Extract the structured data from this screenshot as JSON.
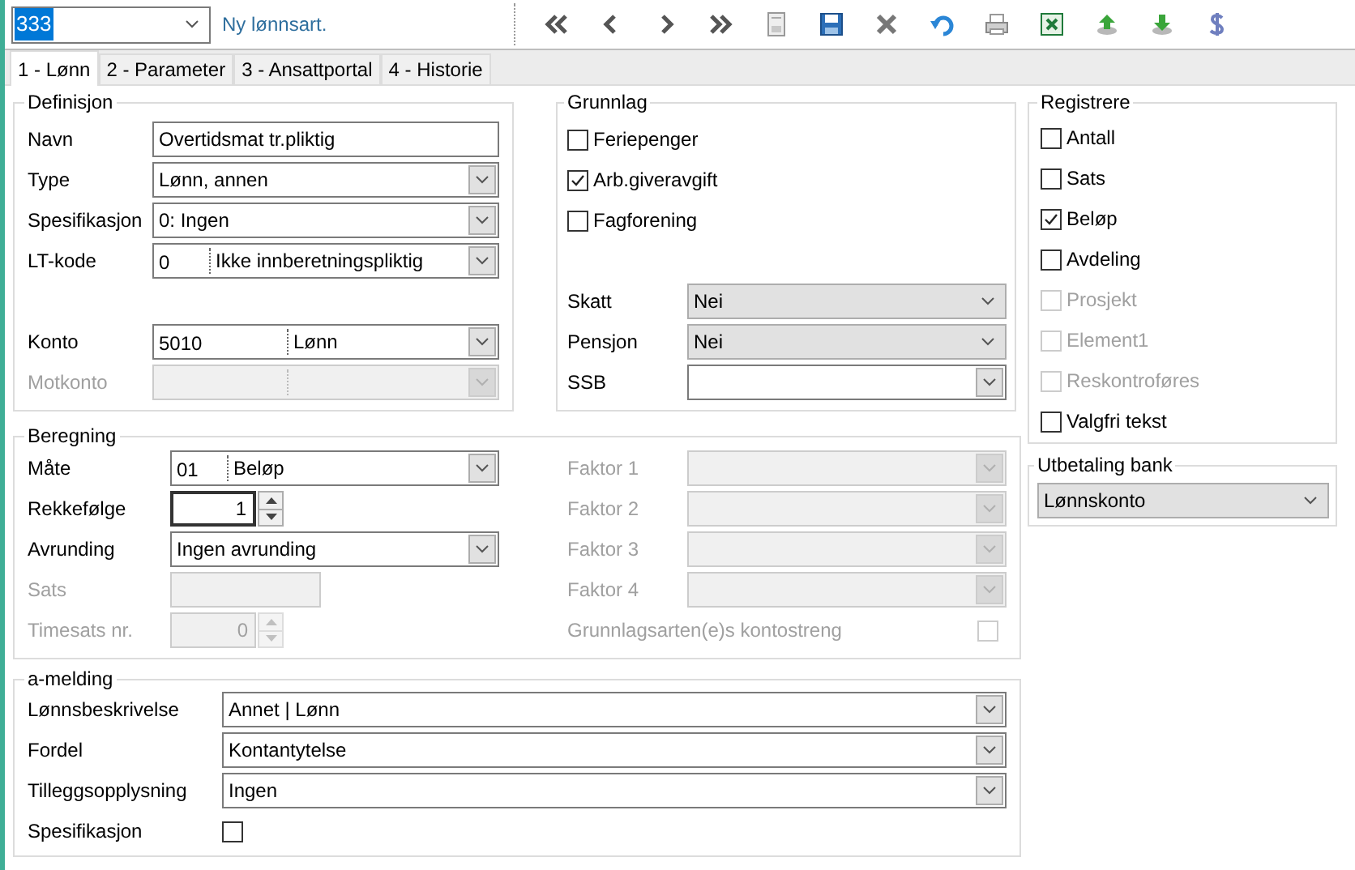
{
  "toolbar": {
    "record": {
      "value": "333",
      "highlighted": true
    },
    "status": "Ny lønnsart."
  },
  "tabs": [
    {
      "label": "1 - Lønn",
      "selected": true
    },
    {
      "label": "2 - Parameter",
      "selected": false
    },
    {
      "label": "3 - Ansattportal",
      "selected": false
    },
    {
      "label": "4 - Historie",
      "selected": false
    }
  ],
  "definisjon": {
    "title": "Definisjon",
    "rows": [
      {
        "label": "Navn",
        "kind": "text",
        "value": "Overtidsmat tr.pliktig",
        "disabled": false
      },
      {
        "label": "Type",
        "kind": "combo",
        "value": "Lønn, annen",
        "disabled": false
      },
      {
        "label": "Spesifikasjon",
        "kind": "combo",
        "value": "0:  Ingen",
        "disabled": false
      },
      {
        "label": "LT-kode",
        "kind": "code-combo",
        "code": "0",
        "value": "Ikke innberetningspliktig",
        "disabled": false
      }
    ],
    "account_rows": [
      {
        "label": "Konto",
        "kind": "account-combo",
        "code": "5010",
        "value": "Lønn",
        "disabled": false
      },
      {
        "label": "Motkonto",
        "kind": "account-combo",
        "disabled": true
      }
    ]
  },
  "grunnlag": {
    "title": "Grunnlag",
    "checks": [
      {
        "label": "Feriepenger",
        "checked": false,
        "disabled": false
      },
      {
        "label": "Arb.giveravgift",
        "checked": true,
        "disabled": false
      },
      {
        "label": "Fagforening",
        "checked": false,
        "disabled": false
      }
    ],
    "rows": [
      {
        "label": "Skatt",
        "kind": "dropdown",
        "value": "Nei",
        "disabled": false
      },
      {
        "label": "Pensjon",
        "kind": "dropdown",
        "value": "Nei",
        "disabled": false
      },
      {
        "label": "SSB",
        "kind": "combo",
        "disabled": false
      }
    ]
  },
  "registrere": {
    "title": "Registrere",
    "checks": [
      {
        "label": "Antall",
        "checked": false,
        "disabled": false
      },
      {
        "label": "Sats",
        "checked": false,
        "disabled": false
      },
      {
        "label": "Beløp",
        "checked": true,
        "disabled": false
      },
      {
        "label": "Avdeling",
        "checked": false,
        "disabled": false
      },
      {
        "label": "Prosjekt",
        "checked": false,
        "disabled": true
      },
      {
        "label": "Element1",
        "checked": false,
        "disabled": true
      },
      {
        "label": "Reskontroføres",
        "checked": false,
        "disabled": true
      },
      {
        "label": "Valgfri tekst",
        "checked": false,
        "disabled": false
      }
    ]
  },
  "utbetaling_bank": {
    "title": "Utbetaling bank",
    "value": "Lønnskonto"
  },
  "beregning": {
    "title": "Beregning",
    "left_rows": [
      {
        "label": "Måte",
        "kind": "code-combo",
        "code": "01",
        "value": "Beløp",
        "disabled": false
      },
      {
        "label": "Rekkefølge",
        "kind": "spin",
        "value": "1",
        "disabled": false
      },
      {
        "label": "Avrunding",
        "kind": "combo",
        "value": "Ingen avrunding",
        "disabled": false
      },
      {
        "label": "Sats",
        "kind": "short-text",
        "disabled": true
      },
      {
        "label": "Timesats nr.",
        "kind": "spin",
        "value": "0",
        "disabled": true
      }
    ],
    "right_rows": [
      {
        "label": "Faktor 1",
        "kind": "combo",
        "disabled": true
      },
      {
        "label": "Faktor 2",
        "kind": "combo",
        "disabled": true
      },
      {
        "label": "Faktor 3",
        "kind": "combo",
        "disabled": true
      },
      {
        "label": "Faktor 4",
        "kind": "combo",
        "disabled": true
      },
      {
        "label": "Grunnlagsarten(e)s kontostreng",
        "kind": "trailing-check",
        "checked": false,
        "disabled": true
      }
    ]
  },
  "a_melding": {
    "title": "a-melding",
    "rows": [
      {
        "label": "Lønnsbeskrivelse",
        "kind": "combo",
        "value": "Annet | Lønn",
        "disabled": false
      },
      {
        "label": "Fordel",
        "kind": "combo",
        "value": "Kontantytelse",
        "disabled": false
      },
      {
        "label": "Tilleggsopplysning",
        "kind": "combo",
        "value": "Ingen",
        "disabled": false
      },
      {
        "label": "Spesifikasjon",
        "kind": "check",
        "checked": false,
        "disabled": false
      }
    ]
  }
}
